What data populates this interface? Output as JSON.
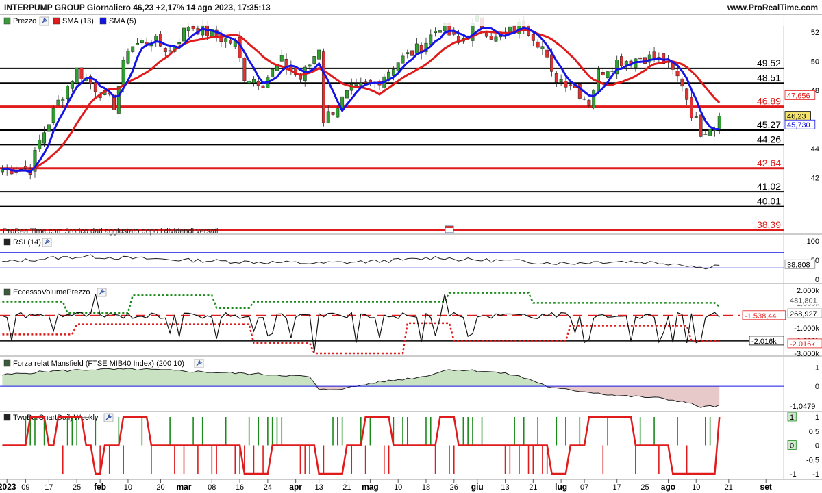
{
  "header": {
    "title": "INTERPUMP GROUP Giornaliero 46,23 +2,17% 14 ago 2023, 17:35:13",
    "site": "www.ProRealTime.com"
  },
  "colors": {
    "red": "#e01b1b",
    "blue": "#1414e6",
    "green": "#1a8a1a",
    "grid": "#000000",
    "volume_green": "#b9dcb2",
    "volume_red": "#e9b8b8",
    "mansfield_pos": "#c9e3c2",
    "mansfield_neg": "#e7c9c9"
  },
  "chart_data": [
    {
      "type": "candlestick",
      "title": "INTERPUMP GROUP Giornaliero",
      "legend": [
        "Prezzo",
        "SMA (13)",
        "SMA (5)"
      ],
      "note": "ProRealTime.com Storico dati aggiustato dopo i dividendi versati",
      "ylim": [
        38.2,
        53.0
      ],
      "y_ticks": [
        42,
        44,
        48,
        50,
        52
      ],
      "x_tick_labels": [
        "2023",
        "09",
        "17",
        "25",
        "feb",
        "10",
        "20",
        "mar",
        "08",
        "16",
        "24",
        "apr",
        "13",
        "21",
        "mag",
        "10",
        "18",
        "26",
        "giu",
        "13",
        "21",
        "lug",
        "07",
        "17",
        "25",
        "ago",
        "10",
        "21",
        "set"
      ],
      "x_tick_index": [
        1,
        5,
        10,
        16,
        21,
        27,
        34,
        39,
        45,
        51,
        57,
        63,
        68,
        74,
        79,
        85,
        91,
        97,
        102,
        108,
        114,
        120,
        125,
        132,
        138,
        143,
        149,
        156,
        164
      ],
      "levels": [
        {
          "value": 49.52,
          "label": "49,52",
          "color": "black"
        },
        {
          "value": 48.51,
          "label": "48,51",
          "color": "black"
        },
        {
          "value": 46.89,
          "label": "46,89",
          "color": "red"
        },
        {
          "value": 45.27,
          "label": "45,27",
          "color": "black"
        },
        {
          "value": 44.26,
          "label": "44,26",
          "color": "black"
        },
        {
          "value": 42.64,
          "label": "42,64",
          "color": "red"
        },
        {
          "value": 41.02,
          "label": "41,02",
          "color": "black"
        },
        {
          "value": 40.01,
          "label": "40,01",
          "color": "black"
        },
        {
          "value": 38.39,
          "label": "38,39",
          "color": "red"
        }
      ],
      "price_boxes": [
        {
          "value": 47.656,
          "label": "47,656",
          "kind": "sma13"
        },
        {
          "value": 46.23,
          "label": "46,23",
          "kind": "last"
        },
        {
          "value": 45.73,
          "label": "45,730",
          "kind": "sma5"
        }
      ],
      "close_points": [
        [
          0,
          42.6
        ],
        [
          6,
          42.6
        ],
        [
          8,
          44.5
        ],
        [
          12,
          47.2
        ],
        [
          16,
          49.4
        ],
        [
          20,
          48.2
        ],
        [
          24,
          47.0
        ],
        [
          27,
          51.0
        ],
        [
          32,
          51.5
        ],
        [
          36,
          50.7
        ],
        [
          40,
          52.5
        ],
        [
          44,
          52.0
        ],
        [
          50,
          51.2
        ],
        [
          52,
          49.0
        ],
        [
          56,
          48.6
        ],
        [
          60,
          50.0
        ],
        [
          64,
          48.8
        ],
        [
          66,
          49.8
        ],
        [
          68,
          51.0
        ],
        [
          69,
          46.0
        ],
        [
          72,
          47.0
        ],
        [
          75,
          48.0
        ],
        [
          80,
          48.5
        ],
        [
          85,
          50.0
        ],
        [
          90,
          51.0
        ],
        [
          94,
          52.5
        ],
        [
          98,
          51.2
        ],
        [
          102,
          52.8
        ],
        [
          106,
          51.5
        ],
        [
          112,
          52.6
        ],
        [
          116,
          51.0
        ],
        [
          118,
          49.0
        ],
        [
          122,
          48.5
        ],
        [
          126,
          47.2
        ],
        [
          128,
          49.2
        ],
        [
          132,
          50.0
        ],
        [
          138,
          50.3
        ],
        [
          142,
          50.0
        ],
        [
          146,
          48.5
        ],
        [
          148,
          46.5
        ],
        [
          150,
          45.2
        ],
        [
          152,
          45.6
        ],
        [
          153,
          45.5
        ],
        [
          154,
          46.23
        ]
      ]
    },
    {
      "type": "line",
      "title": "RSI (14)",
      "ylim": [
        0,
        100
      ],
      "y_ticks": [
        0,
        50,
        100
      ],
      "last_label": "38,808",
      "points": [
        [
          0,
          45
        ],
        [
          10,
          55
        ],
        [
          18,
          60
        ],
        [
          22,
          58
        ],
        [
          28,
          55
        ],
        [
          34,
          53
        ],
        [
          40,
          50
        ],
        [
          46,
          48
        ],
        [
          52,
          46
        ],
        [
          60,
          44
        ],
        [
          68,
          42
        ],
        [
          72,
          44
        ],
        [
          80,
          47
        ],
        [
          88,
          52
        ],
        [
          94,
          58
        ],
        [
          98,
          52
        ],
        [
          104,
          50
        ],
        [
          110,
          48
        ],
        [
          116,
          44
        ],
        [
          122,
          42
        ],
        [
          128,
          46
        ],
        [
          134,
          47
        ],
        [
          140,
          44
        ],
        [
          146,
          40
        ],
        [
          150,
          30
        ],
        [
          153,
          36
        ],
        [
          154,
          38.8
        ]
      ]
    },
    {
      "type": "line",
      "title": "EccessoVolumePrezzo",
      "ylim": [
        -3000,
        2000
      ],
      "y_ticks": [
        2000,
        1000,
        0,
        -1000,
        -2000,
        -3000
      ],
      "y_tick_labels": [
        "2.000k",
        "1.000k",
        "0",
        "-1.000k",
        "-2.000k",
        "-3.000k"
      ],
      "labels": {
        "upper": "481,801",
        "line": "268,927",
        "lower": "-1.538,44",
        "min": "-2.016k",
        "min_box": "-2.016k"
      },
      "upper_band": [
        [
          0,
          1100
        ],
        [
          12,
          1100
        ],
        [
          14,
          200
        ],
        [
          26,
          200
        ],
        [
          28,
          1600
        ],
        [
          44,
          1600
        ],
        [
          46,
          600
        ],
        [
          52,
          600
        ],
        [
          54,
          1100
        ],
        [
          94,
          1100
        ],
        [
          96,
          1800
        ],
        [
          112,
          1800
        ],
        [
          114,
          1000
        ],
        [
          152,
          1000
        ],
        [
          154,
          700
        ]
      ],
      "lower_band": [
        [
          0,
          -1500
        ],
        [
          14,
          -1500
        ],
        [
          16,
          -700
        ],
        [
          52,
          -700
        ],
        [
          54,
          -2200
        ],
        [
          66,
          -2200
        ],
        [
          67,
          -3000
        ],
        [
          86,
          -3000
        ],
        [
          87,
          -600
        ],
        [
          96,
          -600
        ],
        [
          97,
          -2000
        ],
        [
          120,
          -2000
        ],
        [
          122,
          -800
        ],
        [
          146,
          -800
        ],
        [
          148,
          -2016
        ],
        [
          154,
          -2016
        ]
      ],
      "baseline": 0,
      "current_marker": -1538.44
    },
    {
      "type": "area",
      "title": "Forza relat Mansfield (FTSE MIB40 Index) (200 10)",
      "ylim": [
        -1.2,
        1.1
      ],
      "y_ticks": [
        1,
        0,
        -1
      ],
      "last_label": "-1,0479",
      "points": [
        [
          0,
          0.6
        ],
        [
          10,
          0.8
        ],
        [
          20,
          0.9
        ],
        [
          30,
          0.9
        ],
        [
          40,
          0.8
        ],
        [
          50,
          0.7
        ],
        [
          60,
          0.6
        ],
        [
          66,
          0.5
        ],
        [
          68,
          -0.2
        ],
        [
          74,
          -0.1
        ],
        [
          80,
          0.2
        ],
        [
          90,
          0.5
        ],
        [
          96,
          0.9
        ],
        [
          104,
          0.8
        ],
        [
          110,
          0.6
        ],
        [
          114,
          0.3
        ],
        [
          118,
          -0.1
        ],
        [
          122,
          -0.2
        ],
        [
          126,
          -0.3
        ],
        [
          132,
          -0.5
        ],
        [
          140,
          -0.6
        ],
        [
          146,
          -0.8
        ],
        [
          150,
          -1.1
        ],
        [
          154,
          -1.05
        ]
      ]
    },
    {
      "type": "line",
      "title": "TwoBarChartDailyWeekly",
      "ylim": [
        -1,
        1
      ],
      "y_ticks": [
        1,
        0.5,
        0,
        -0.5,
        -1
      ],
      "y_tick_labels": [
        "1",
        "0,5",
        "0",
        "-0,5",
        "-1"
      ],
      "last_label_top": "1",
      "last_label_mid": "0",
      "last_label_bot": "-1",
      "signal": [
        [
          0,
          0
        ],
        [
          4,
          0
        ],
        [
          6,
          1
        ],
        [
          10,
          0
        ],
        [
          12,
          1
        ],
        [
          18,
          0
        ],
        [
          20,
          -1
        ],
        [
          22,
          0
        ],
        [
          26,
          1
        ],
        [
          32,
          0
        ],
        [
          40,
          0
        ],
        [
          50,
          0
        ],
        [
          52,
          -1
        ],
        [
          56,
          -1
        ],
        [
          58,
          0
        ],
        [
          66,
          0
        ],
        [
          68,
          -1
        ],
        [
          74,
          0
        ],
        [
          78,
          1
        ],
        [
          84,
          0
        ],
        [
          94,
          1
        ],
        [
          98,
          0
        ],
        [
          108,
          0
        ],
        [
          112,
          0
        ],
        [
          118,
          -1
        ],
        [
          122,
          0
        ],
        [
          126,
          1
        ],
        [
          136,
          0
        ],
        [
          144,
          -1
        ],
        [
          152,
          -1
        ],
        [
          154,
          1
        ]
      ]
    }
  ]
}
